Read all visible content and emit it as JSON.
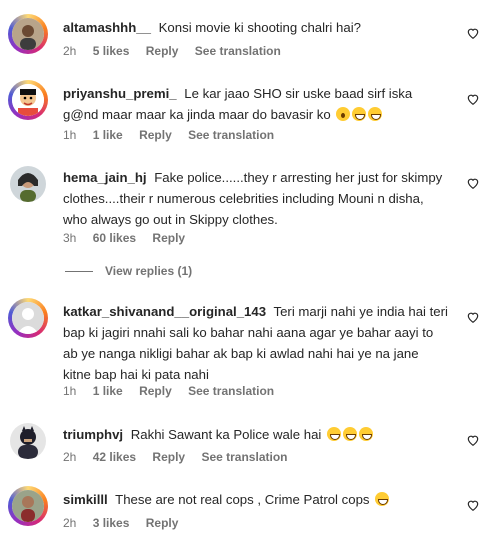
{
  "comments": [
    {
      "username": "altamashhh__",
      "text": "Konsi movie ki shooting chalri hai?",
      "time": "2h",
      "likes": "5 likes",
      "reply": "Reply",
      "translate": "See translation"
    },
    {
      "username": "priyanshu_premi_",
      "text": "Le kar jaao SHO sir uske baad sirf iska g@nd maar maar ka jinda maar do bavasir ko",
      "time": "1h",
      "likes": "1 like",
      "reply": "Reply",
      "translate": "See translation"
    },
    {
      "username": "hema_jain_hj",
      "text": "Fake police......they r arresting her just for skimpy clothes....their r numerous celebrities including Mouni n disha, who always go out in Skippy clothes.",
      "time": "3h",
      "likes": "60 likes",
      "reply": "Reply"
    },
    {
      "username": "katkar_shivanand__original_143",
      "text": "Teri marji nahi ye india hai teri bap ki jagiri nnahi sali ko bahar nahi aana agar ye bahar aayi to ab ye nanga nikligi bahar ak bap ki awlad nahi hai ye na jane kitne bap hai ki pata nahi",
      "time": "1h",
      "likes": "1 like",
      "reply": "Reply",
      "translate": "See translation"
    },
    {
      "username": "triumphvj",
      "text": "Rakhi Sawant ka Police wale hai",
      "time": "2h",
      "likes": "42 likes",
      "reply": "Reply",
      "translate": "See translation"
    },
    {
      "username": "simkilll",
      "text": "These are not real cops , Crime Patrol cops",
      "time": "2h",
      "likes": "3 likes",
      "reply": "Reply"
    }
  ],
  "view_replies": "View replies (1)",
  "colors": {
    "text": "#262626",
    "muted": "#737373",
    "background": "#ffffff"
  },
  "icons": {
    "like": "heart-outline-icon"
  }
}
